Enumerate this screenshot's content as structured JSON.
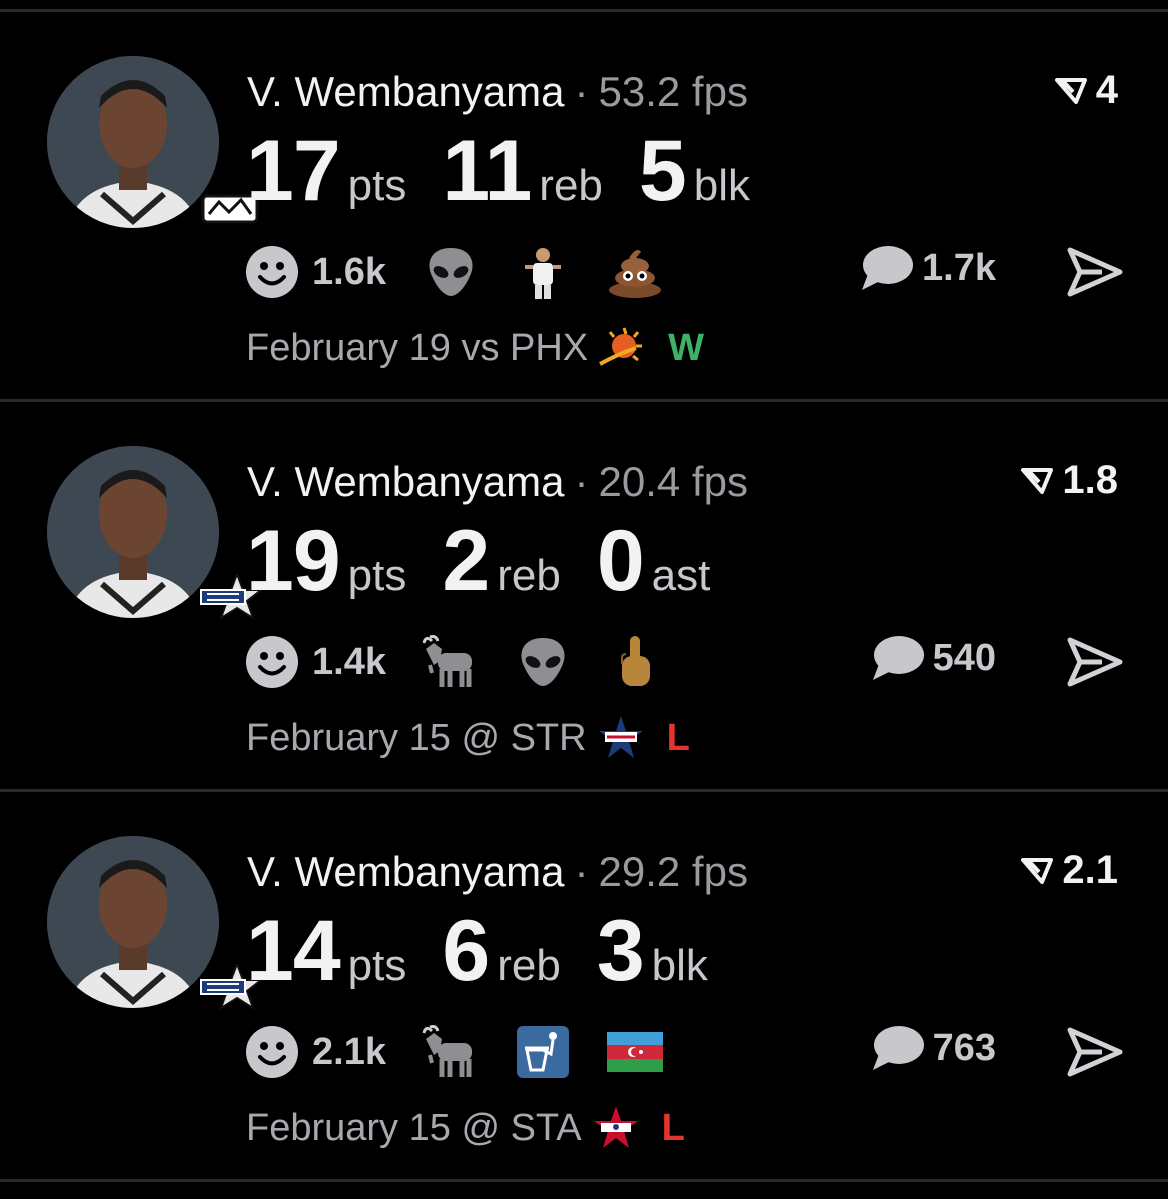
{
  "feed": {
    "cards": [
      {
        "player": "V. Wembanyama",
        "separator": "·",
        "fps": "53.2 fps",
        "rating": "4",
        "badge": "spurs-logo",
        "stats": [
          {
            "value": "17",
            "unit": "pts"
          },
          {
            "value": "11",
            "unit": "reb"
          },
          {
            "value": "5",
            "unit": "blk"
          }
        ],
        "reaction_count": "1.6k",
        "reaction_emojis": [
          "alien-emoji",
          "player-sticker-emoji",
          "poop-emoji"
        ],
        "comment_count": "1.7k",
        "game": "February 19 vs PHX",
        "team_logo": "suns-logo",
        "result": "W"
      },
      {
        "player": "V. Wembanyama",
        "separator": "·",
        "fps": "20.4 fps",
        "rating": "1.8",
        "badge": "world-allstar-logo",
        "stats": [
          {
            "value": "19",
            "unit": "pts"
          },
          {
            "value": "2",
            "unit": "reb"
          },
          {
            "value": "0",
            "unit": "ast"
          }
        ],
        "reaction_count": "1.4k",
        "reaction_emojis": [
          "goat-emoji",
          "alien-emoji",
          "middle-finger-emoji"
        ],
        "comment_count": "540",
        "game": "February 15 @ STR",
        "team_logo": "usa-stripes-logo",
        "result": "L"
      },
      {
        "player": "V. Wembanyama",
        "separator": "·",
        "fps": "29.2 fps",
        "rating": "2.1",
        "badge": "world-allstar-logo",
        "stats": [
          {
            "value": "14",
            "unit": "pts"
          },
          {
            "value": "6",
            "unit": "reb"
          },
          {
            "value": "3",
            "unit": "blk"
          }
        ],
        "reaction_count": "2.1k",
        "reaction_emojis": [
          "goat-emoji",
          "trash-can-emoji",
          "azerbaijan-flag-emoji"
        ],
        "comment_count": "763",
        "game": "February 15 @ STA",
        "team_logo": "usa-stars-logo",
        "result": "L"
      }
    ]
  },
  "colors": {
    "background": "#000000",
    "divider": "#2a2a2c",
    "win": "#3fb26a",
    "loss": "#e5342f",
    "muted_text": "#a8a8ae"
  }
}
